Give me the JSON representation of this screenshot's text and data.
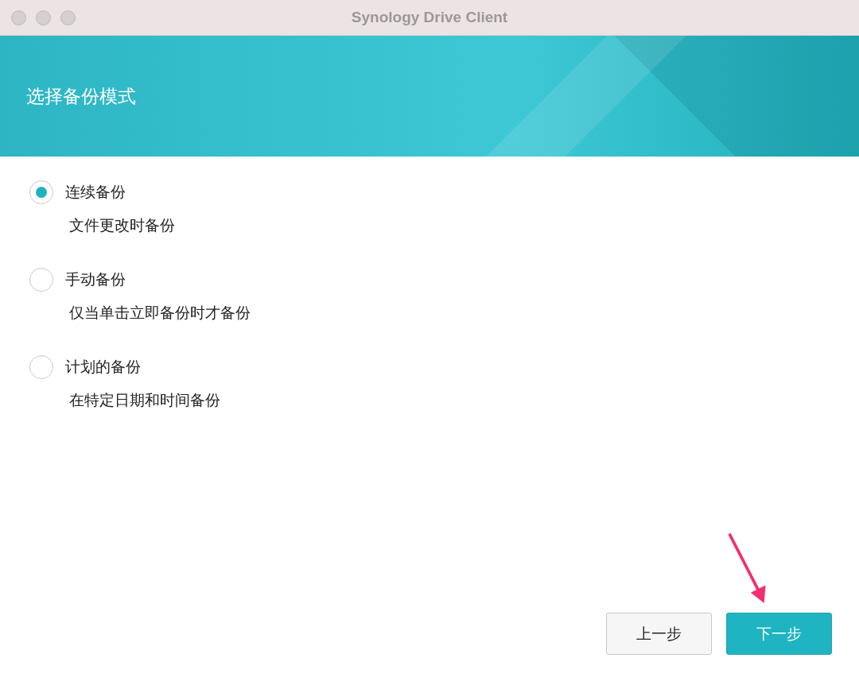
{
  "window": {
    "title": "Synology Drive Client"
  },
  "header": {
    "title": "选择备份模式"
  },
  "options": [
    {
      "label": "连续备份",
      "description": "文件更改时备份",
      "selected": true
    },
    {
      "label": "手动备份",
      "description": "仅当单击立即备份时才备份",
      "selected": false
    },
    {
      "label": "计划的备份",
      "description": "在特定日期和时间备份",
      "selected": false
    }
  ],
  "buttons": [
    {
      "label": "上一步",
      "kind": "secondary"
    },
    {
      "label": "下一步",
      "kind": "primary"
    }
  ]
}
